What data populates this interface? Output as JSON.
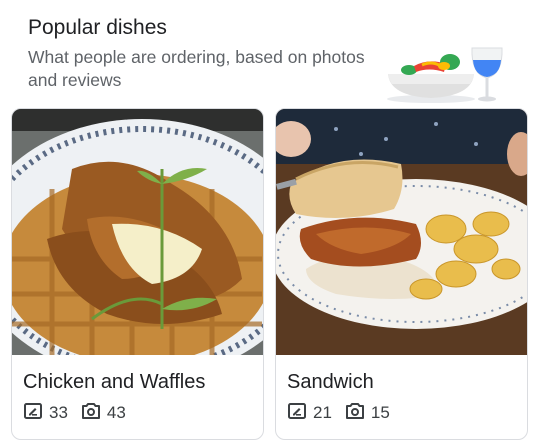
{
  "header": {
    "title": "Popular dishes",
    "subtitle": "What people are ordering, based on photos and reviews"
  },
  "dishes": [
    {
      "name": "Chicken and Waffles",
      "reviews": "33",
      "photos": "43",
      "icons": {
        "review": "review-icon",
        "photo": "camera-icon"
      }
    },
    {
      "name": "Sandwich",
      "reviews": "21",
      "photos": "15",
      "icons": {
        "review": "review-icon",
        "photo": "camera-icon"
      }
    }
  ],
  "colors": {
    "title": "#202124",
    "subtitle": "#5f6368",
    "stat_text": "#3c4043",
    "card_border": "#dadce0"
  }
}
